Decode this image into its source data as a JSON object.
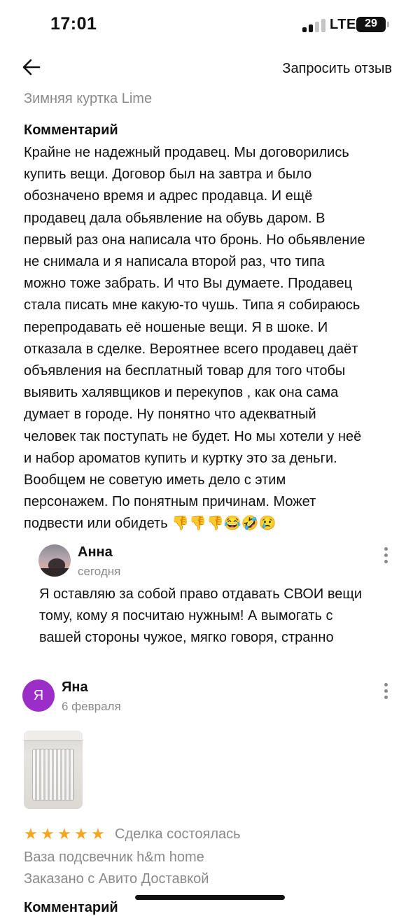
{
  "status_bar": {
    "time": "17:01",
    "network": "LTE",
    "battery": "29"
  },
  "nav": {
    "back_icon": "arrow-left-icon",
    "request_review": "Запросить отзыв"
  },
  "product_name": "Зимняя куртка Lime",
  "comment": {
    "title": "Комментарий",
    "text": "Крайне не надежный продавец. Мы договорились\nкупить вещи. Договор был на завтра  и было\nобозначено время и адрес продавца. И ещё\nпродавец дала обьявление на обувь даром. В\nпервый раз она написала что бронь. Но обьявление\nне снимала и я написала второй раз, что типа\nможно тоже забрать. И что Вы думаете. Продавец\nстала писать мне какую-то чушь. Типа я собираюсь\nперепродавать её ношеные вещи. Я в шоке. И\nотказала в сделке. Вероятнее всего продавец даёт\nобъявления на бесплатный товар для того чтобы\nвыявить халявщиков и перекупов , как она сама\nдумает в городе. Ну понятно что адекватный\nчеловек так поступать не будет. Но мы хотели у неё\nи набор ароматов купить и куртку это за деньги.\nВообщем не советую иметь дело с этим\nперсонажем. По понятным причинам. Может\nподвести или обидеть 👎👎👎😂🤣😢"
  },
  "reply": {
    "author": "Анна",
    "date": "сегодня",
    "text": "Я оставляю за собой право отдавать СВОИ вещи\nтому, кому я посчитаю нужным! А вымогать с\nвашей стороны чужое, мягко говоря, странно",
    "more_icon": "more-vertical-icon"
  },
  "review": {
    "avatar_letter": "Я",
    "avatar_color": "#9b2ec7",
    "author": "Яна",
    "date": "6 февраля",
    "rating": 5,
    "star_glyph": "★",
    "star_color": "#f5a623",
    "status": "Сделка состоялась",
    "item": "Ваза подсвечник h&m home",
    "delivery": "Заказано с Авито Доставкой",
    "next_heading": "Комментарий",
    "more_icon": "more-vertical-icon"
  }
}
